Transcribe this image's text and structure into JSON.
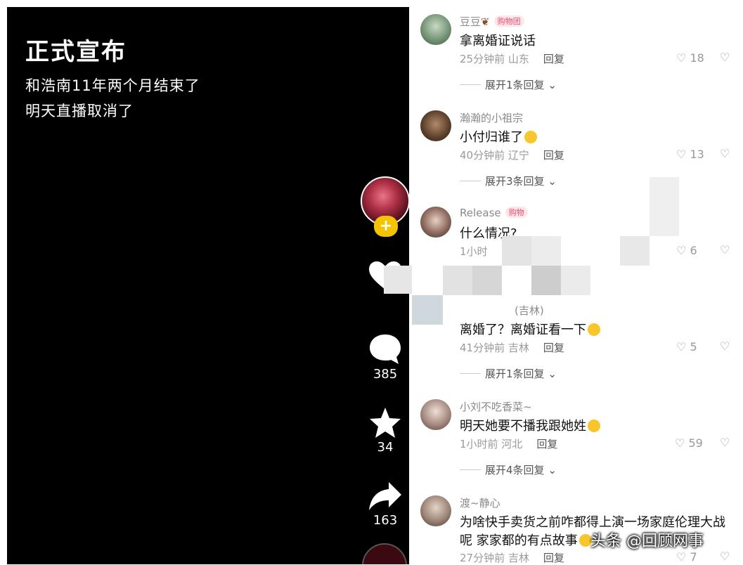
{
  "video": {
    "title": "正式宣布",
    "line1": "和浩南11年两个月结束了",
    "line2": "明天直播取消了",
    "comment_count": "385",
    "favorite_count": "34",
    "share_count": "163"
  },
  "comments": [
    {
      "user": "豆豆",
      "badge": "购物团",
      "text": "拿离婚证说话",
      "meta": "25分钟前 山东",
      "reply": "回复",
      "likes": "18",
      "expand": "展开1条回复"
    },
    {
      "user": "瀚瀚的小祖宗",
      "text": "小付归谁了",
      "meta": "40分钟前 辽宁",
      "reply": "回复",
      "likes": "13",
      "expand": "展开3条回复"
    },
    {
      "user": "Release",
      "badge": "购物",
      "text": "什么情况?",
      "meta": "1小时",
      "likes": "6"
    },
    {
      "user": "(吉林)",
      "text": "离婚了？离婚证看一下",
      "meta": "41分钟前 吉林",
      "reply": "回复",
      "likes": "5",
      "expand": "展开1条回复"
    },
    {
      "user": "小刘不吃香菜~",
      "text": "明天她要不播我跟她姓",
      "meta": "1小时前 河北",
      "reply": "回复",
      "likes": "59",
      "expand": "展开4条回复"
    },
    {
      "user": "渡~静心",
      "text": "为啥快手卖货之前咋都得上演一场家庭伦理大战",
      "text2": "呢 家家都的有点故事",
      "meta": "27分钟前 吉林",
      "reply": "回复",
      "likes": "7"
    }
  ],
  "watermark": "头条 @回顾网事"
}
